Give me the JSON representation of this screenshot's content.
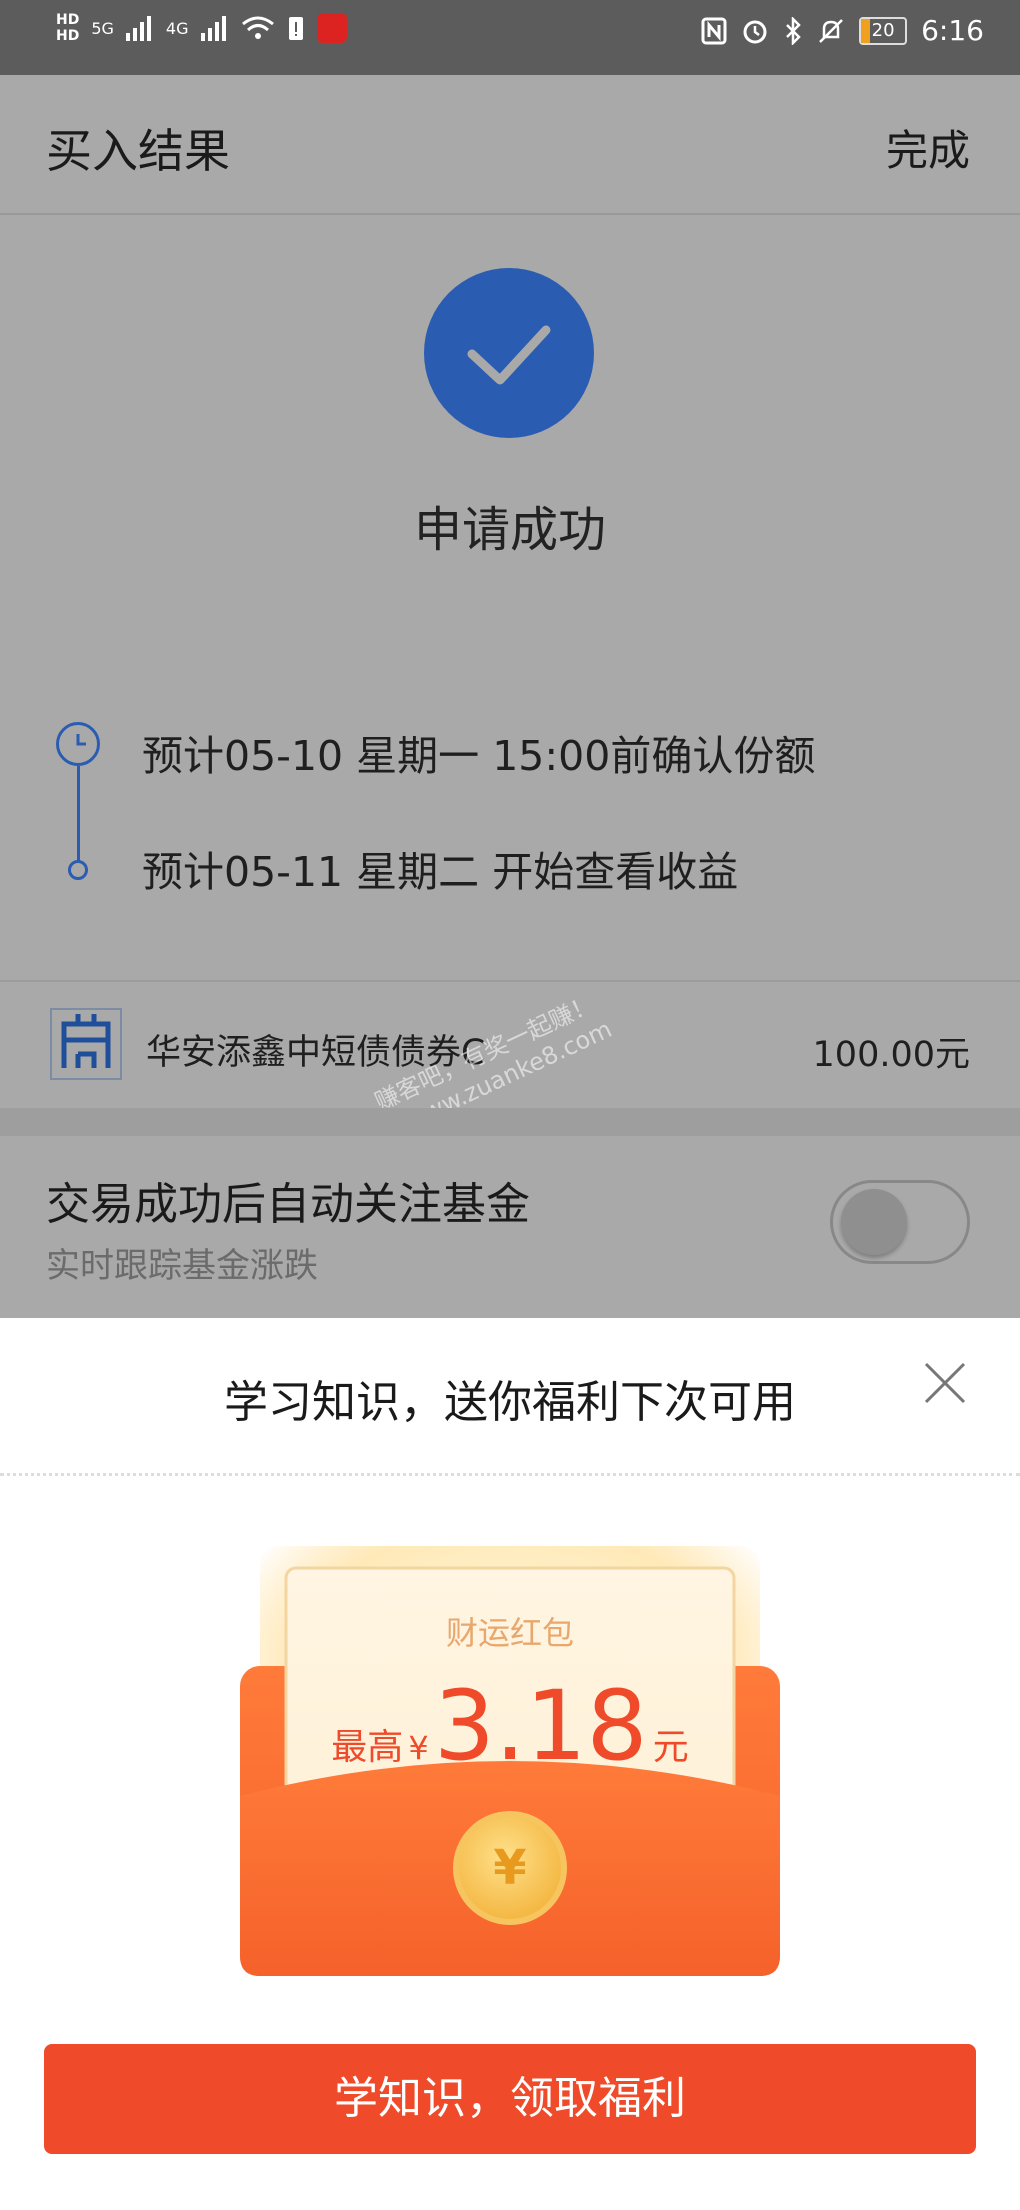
{
  "status_bar": {
    "left": [
      "HD",
      "5G",
      "4G"
    ],
    "time": "6:16",
    "battery": "20"
  },
  "header": {
    "title": "买入结果",
    "done": "完成"
  },
  "result": {
    "status": "申请成功"
  },
  "timeline": [
    {
      "text": "预计05-10 星期一 15:00前确认份额"
    },
    {
      "text": "预计05-11 星期二 开始查看收益"
    }
  ],
  "fund": {
    "name": "华安添鑫中短债债券C",
    "amount": "100.00元"
  },
  "follow": {
    "title": "交易成功后自动关注基金",
    "subtitle": "实时跟踪基金涨跌",
    "enabled": false
  },
  "sheet": {
    "title": "学习知识，送你福利下次可用",
    "red_packet": {
      "label": "财运红包",
      "prefix": "最高",
      "currency": "¥",
      "amount": "3.18",
      "unit": "元",
      "coin": "¥"
    },
    "cta": "学知识，领取福利"
  },
  "watermark": {
    "line1": "赚客吧，有奖一起赚！",
    "line2": "www.zuanke8.com"
  },
  "colors": {
    "accent_blue": "#2a5cb1",
    "cta_red": "#ef4a29",
    "packet_orange": "#f5612a"
  }
}
